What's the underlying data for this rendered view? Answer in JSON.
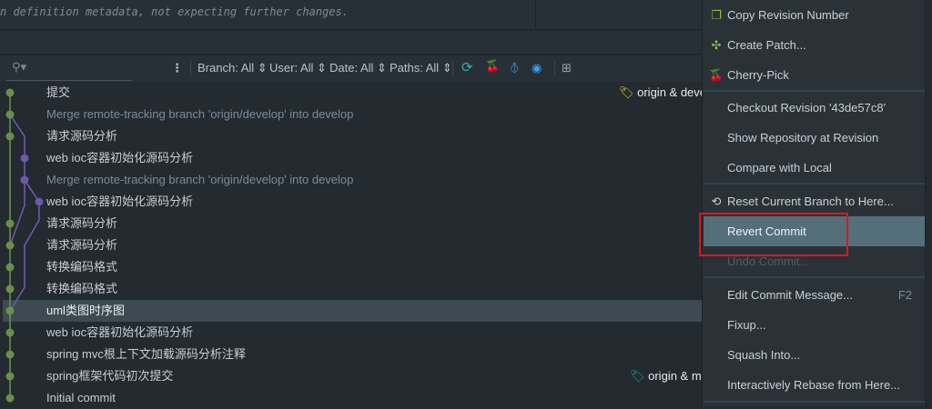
{
  "commit_message_fragment": "n definition metadata, not expecting further changes.",
  "toolbar": {
    "search_placeholder": "",
    "filters": [
      "Branch: All",
      "User: All",
      "Date: All",
      "Paths: All"
    ]
  },
  "commits": [
    {
      "subject": "提交",
      "merge": false,
      "ref": "origin & deve"
    },
    {
      "subject": "Merge remote-tracking branch 'origin/develop' into develop",
      "merge": true
    },
    {
      "subject": "请求源码分析",
      "merge": false
    },
    {
      "subject": "web ioc容器初始化源码分析",
      "merge": false
    },
    {
      "subject": "Merge remote-tracking branch 'origin/develop' into develop",
      "merge": true
    },
    {
      "subject": "web ioc容器初始化源码分析",
      "merge": false
    },
    {
      "subject": "请求源码分析",
      "merge": false
    },
    {
      "subject": "请求源码分析",
      "merge": false
    },
    {
      "subject": "转换编码格式",
      "merge": false
    },
    {
      "subject": "转换编码格式",
      "merge": false
    },
    {
      "subject": "uml类图时序图",
      "merge": false,
      "selected": true
    },
    {
      "subject": "web ioc容器初始化源码分析",
      "merge": false
    },
    {
      "subject": "spring mvc根上下文加载源码分析注释",
      "merge": false
    },
    {
      "subject": "spring框架代码初次提交",
      "merge": false,
      "ref": "origin & ma"
    },
    {
      "subject": "Initial commit",
      "merge": false
    }
  ],
  "context_menu": {
    "items": [
      {
        "label": "Copy Revision Number",
        "icon": "copy-icon"
      },
      {
        "label": "Create Patch...",
        "icon": "patch-icon"
      },
      {
        "label": "Cherry-Pick",
        "icon": "cherry-icon"
      },
      {
        "label": "Checkout Revision '43de57c8'"
      },
      {
        "label": "Show Repository at Revision"
      },
      {
        "label": "Compare with Local"
      },
      {
        "label": "Reset Current Branch to Here...",
        "icon": "reset-icon"
      },
      {
        "label": "Revert Commit",
        "highlighted": true
      },
      {
        "label": "Undo Commit...",
        "disabled": true
      },
      {
        "label": "Edit Commit Message...",
        "shortcut": "F2"
      },
      {
        "label": "Fixup..."
      },
      {
        "label": "Squash Into..."
      },
      {
        "label": "Interactively Rebase from Here..."
      }
    ]
  },
  "colors": {
    "main_branch": "#6a8f4a",
    "side_branch": "#6f58a8",
    "highlight": "#546e7a",
    "annotation": "#e0161b"
  }
}
